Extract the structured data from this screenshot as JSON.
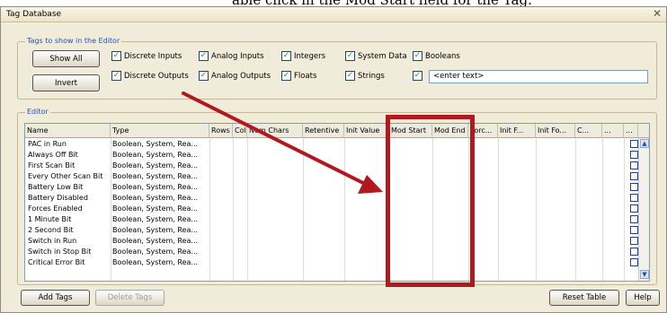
{
  "caption": "able click in the Mod Start field for the Tag.",
  "window": {
    "title": "Tag Database",
    "close": "✕"
  },
  "tags_group": {
    "legend": "Tags to show in the Editor",
    "show_all_label": "Show All",
    "invert_label": "Invert",
    "checkboxes": [
      {
        "label": "Discrete Inputs",
        "checked": true
      },
      {
        "label": "Analog Inputs",
        "checked": true
      },
      {
        "label": "Integers",
        "checked": true
      },
      {
        "label": "System Data",
        "checked": true
      },
      {
        "label": "Booleans",
        "checked": true
      },
      {
        "label": "Discrete Outputs",
        "checked": true
      },
      {
        "label": "Analog Outputs",
        "checked": true
      },
      {
        "label": "Floats",
        "checked": true
      },
      {
        "label": "Strings",
        "checked": true
      },
      {
        "label": "",
        "checked": true
      }
    ],
    "text_value": "<enter text>"
  },
  "editor": {
    "legend": "Editor",
    "columns": [
      "Name",
      "Type",
      "Rows",
      "Cols",
      "Num Chars",
      "Retentive",
      "Init Value",
      "Mod Start",
      "Mod End",
      "Forc...",
      "Init F...",
      "Init Fo...",
      "C...",
      "...",
      "..."
    ],
    "rows": [
      {
        "name": "PAC in Run",
        "type": "Boolean, System, Rea..."
      },
      {
        "name": "Always Off Bit",
        "type": "Boolean, System, Rea..."
      },
      {
        "name": "First Scan Bit",
        "type": "Boolean, System, Rea..."
      },
      {
        "name": "Every Other Scan Bit",
        "type": "Boolean, System, Rea..."
      },
      {
        "name": "Battery Low Bit",
        "type": "Boolean, System, Rea..."
      },
      {
        "name": "Battery Disabled",
        "type": "Boolean, System, Rea..."
      },
      {
        "name": "Forces Enabled",
        "type": "Boolean, System, Rea..."
      },
      {
        "name": "1 Minute Bit",
        "type": "Boolean, System, Rea..."
      },
      {
        "name": "2 Second Bit",
        "type": "Boolean, System, Rea..."
      },
      {
        "name": "Switch in Run",
        "type": "Boolean, System, Rea..."
      },
      {
        "name": "Switch in Stop Bit",
        "type": "Boolean, System, Rea..."
      },
      {
        "name": "Critical Error Bit",
        "type": "Boolean, System, Rea..."
      }
    ]
  },
  "footer": {
    "add_tags_label": "Add Tags",
    "delete_tags_label": "Delete Tags",
    "reset_table_label": "Reset Table",
    "help_label": "Help"
  },
  "icons": {
    "scroll_up": "scroll-up-icon",
    "scroll_down": "scroll-down-icon"
  },
  "colors": {
    "highlight": "#b3181e",
    "legend": "#1c52c6"
  }
}
